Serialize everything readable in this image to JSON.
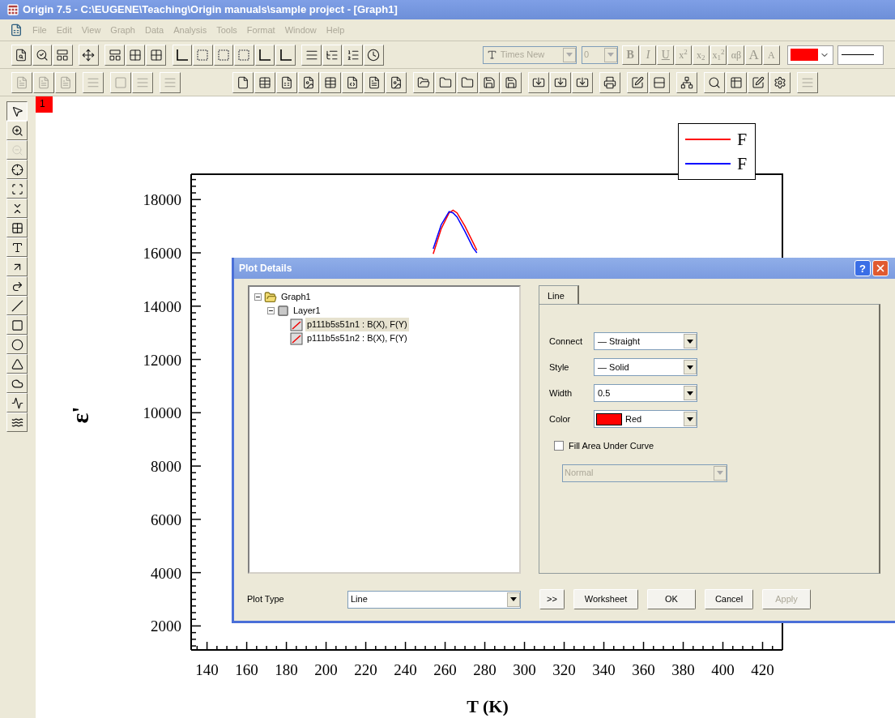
{
  "window": {
    "title": "Origin 7.5 - C:\\EUGENE\\Teaching\\Origin manuals\\sample project - [Graph1]"
  },
  "menu": [
    {
      "label": "File",
      "disabled": true
    },
    {
      "label": "Edit",
      "disabled": true
    },
    {
      "label": "View",
      "disabled": true
    },
    {
      "label": "Graph",
      "disabled": true
    },
    {
      "label": "Data",
      "disabled": true
    },
    {
      "label": "Analysis",
      "disabled": true
    },
    {
      "label": "Tools",
      "disabled": true
    },
    {
      "label": "Format",
      "disabled": true
    },
    {
      "label": "Window",
      "disabled": true
    },
    {
      "label": "Help",
      "disabled": true
    }
  ],
  "format_toolbar": {
    "font": "Times New",
    "size": "0",
    "buttons": [
      {
        "label": "B",
        "kind": "bold",
        "disabled": true
      },
      {
        "label": "I",
        "kind": "italic",
        "disabled": true
      },
      {
        "label": "U",
        "kind": "underline",
        "disabled": true
      },
      {
        "label": "x$^{2}$",
        "kind": "plain",
        "disabled": true
      },
      {
        "label": "x$_{2}$",
        "kind": "plain",
        "disabled": true
      },
      {
        "label": "x$_{1}$$^{2}$",
        "kind": "plain",
        "disabled": true
      },
      {
        "label": "αβ",
        "kind": "plain",
        "disabled": true
      },
      {
        "label": "A",
        "kind": "grow",
        "disabled": true
      },
      {
        "label": "A",
        "kind": "shrink",
        "disabled": true
      }
    ],
    "color": "#ff0000"
  },
  "tools": [
    {
      "selected": true,
      "disabled": false
    },
    {
      "selected": false,
      "disabled": false
    },
    {
      "selected": false,
      "disabled": true
    },
    {
      "selected": false,
      "disabled": false
    },
    {
      "selected": false,
      "disabled": false
    },
    {
      "selected": false,
      "disabled": false
    },
    {
      "selected": false,
      "disabled": false
    },
    {
      "selected": false,
      "disabled": false
    },
    {
      "selected": false,
      "disabled": false
    },
    {
      "selected": false,
      "disabled": false
    },
    {
      "selected": false,
      "disabled": false
    },
    {
      "selected": false,
      "disabled": false
    },
    {
      "selected": false,
      "disabled": false
    },
    {
      "selected": false,
      "disabled": false
    },
    {
      "selected": false,
      "disabled": false
    },
    {
      "selected": false,
      "disabled": false
    },
    {
      "selected": false,
      "disabled": false
    }
  ],
  "graph": {
    "layer_badge": "1",
    "chart_data": {
      "type": "line",
      "xlabel": "T (K)",
      "ylabel": "ε'",
      "x": [
        254,
        258,
        262,
        264,
        266,
        270,
        274,
        276
      ],
      "series": [
        {
          "name": "F",
          "color": "#ff0000",
          "values": [
            15960,
            16900,
            17500,
            17600,
            17500,
            17000,
            16400,
            16100
          ]
        },
        {
          "name": "F",
          "color": "#0000ff",
          "values": [
            16150,
            17050,
            17550,
            17500,
            17350,
            16800,
            16200,
            16000
          ]
        }
      ],
      "xlim": [
        132,
        430
      ],
      "ylim": [
        1100,
        18950
      ],
      "xticks": [
        140,
        160,
        180,
        200,
        220,
        240,
        260,
        280,
        300,
        320,
        340,
        360,
        380,
        400,
        420
      ],
      "yticks": [
        2000,
        4000,
        6000,
        8000,
        10000,
        12000,
        14000,
        16000,
        18000
      ]
    }
  },
  "dialog": {
    "title": "Plot Details",
    "help_label": "?",
    "tree": [
      {
        "label": "Graph1",
        "kind": "folder",
        "expanded": true,
        "selected": false,
        "children": [
          {
            "label": "Layer1",
            "kind": "layer",
            "expanded": true,
            "selected": false,
            "children": [
              {
                "label": "p111b5s51n1 : B(X), F(Y)",
                "kind": "plot",
                "selected": true
              },
              {
                "label": "p111b5s51n2 : B(X), F(Y)",
                "kind": "plot",
                "selected": false
              }
            ]
          }
        ]
      }
    ],
    "tabs": [
      {
        "label": "Line",
        "selected": true
      }
    ],
    "fields": [
      {
        "label": "Connect",
        "value": "— Straight"
      },
      {
        "label": "Style",
        "value": "— Solid"
      },
      {
        "label": "Width",
        "value": "0.5"
      },
      {
        "label": "Color",
        "value": "Red",
        "color": "#ff0000"
      }
    ],
    "fill_area": {
      "label": "Fill Area Under Curve",
      "checked": false
    },
    "fill_mode": {
      "value": "Normal",
      "disabled": true
    },
    "plot_type": {
      "label": "Plot Type",
      "value": "Line"
    },
    "buttons": [
      {
        "label": ">>",
        "disabled": false
      },
      {
        "label": "Worksheet",
        "disabled": false
      },
      {
        "label": "OK",
        "disabled": false
      },
      {
        "label": "Cancel",
        "disabled": false
      },
      {
        "label": "Apply",
        "disabled": true
      }
    ]
  }
}
